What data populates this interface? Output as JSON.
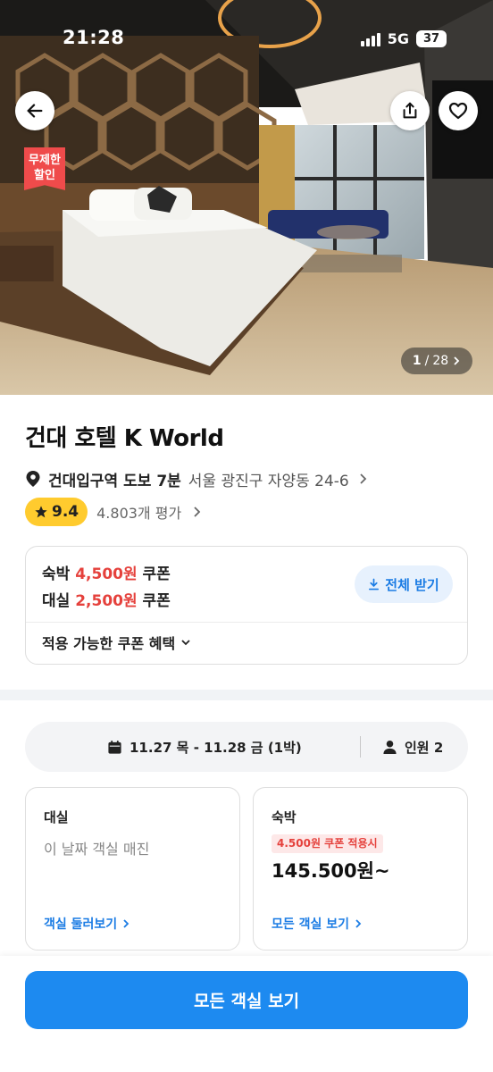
{
  "status_bar": {
    "time": "21:28",
    "network": "5G",
    "battery": "37"
  },
  "gallery": {
    "current": "1",
    "total": "28",
    "separator": "/"
  },
  "promo_badge": {
    "line1": "무제한",
    "line2": "할인"
  },
  "hotel": {
    "name": "건대 호텔 K World",
    "station": "건대입구역 도보 7분",
    "address": "서울 광진구 자양동 24-6",
    "rating": "9.4",
    "review_count": "4.803개 평가"
  },
  "coupons": {
    "stay_label": "숙박",
    "stay_amount": "4,500원",
    "rent_label": "대실",
    "rent_amount": "2,500원",
    "coupon_word": "쿠폰",
    "download_all": "전체 받기",
    "benefit_toggle": "적용 가능한 쿠폰 혜택"
  },
  "booking": {
    "dates": "11.27 목 - 11.28 금 (1박)",
    "guests": "인원 2"
  },
  "rooms": {
    "rent": {
      "title": "대실",
      "status": "이 날짜 객실 매진",
      "link": "객실 둘러보기"
    },
    "stay": {
      "title": "숙박",
      "coupon_tag": "4.500원 쿠폰 적용시",
      "price": "145.500원~",
      "link": "모든 객실 보기"
    }
  },
  "cta": {
    "label": "모든 객실 보기"
  },
  "colors": {
    "accent": "#1d8af0",
    "coupon_red": "#e5413c",
    "rating_yellow": "#ffcb2e",
    "promo_red": "#ef4b4b"
  },
  "icons": [
    "back-arrow-icon",
    "share-icon",
    "heart-icon",
    "location-pin-icon",
    "star-icon",
    "download-icon",
    "calendar-icon",
    "person-icon",
    "chevron-right-icon",
    "chevron-down-icon"
  ]
}
